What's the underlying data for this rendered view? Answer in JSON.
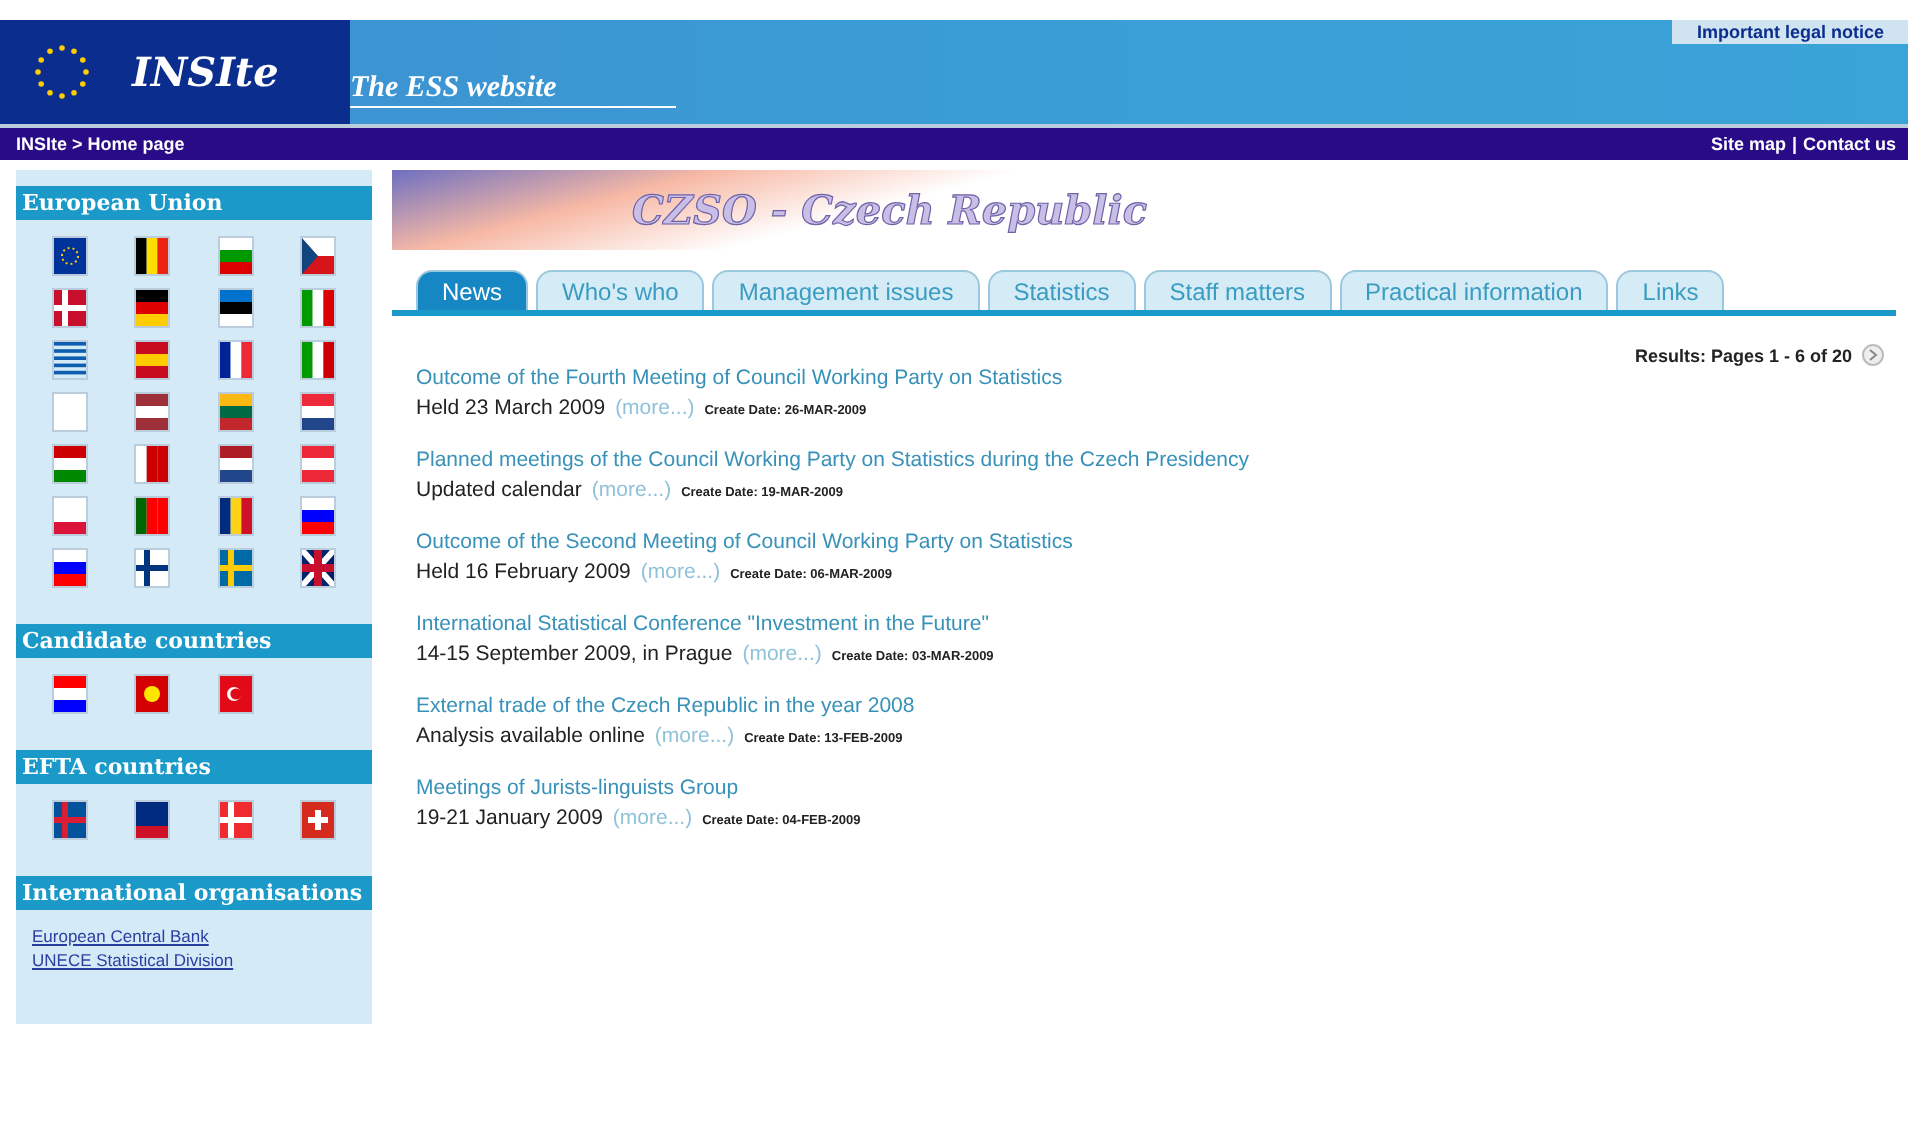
{
  "header": {
    "logo": "INSIte",
    "tagline": "The ESS website",
    "legal_link": "Important legal notice"
  },
  "breadcrumb": "INSIte > Home page",
  "top_links": [
    "Site map",
    "|",
    "Contact us"
  ],
  "sidebar": {
    "sections": [
      {
        "title": "European Union",
        "kind": "flags"
      },
      {
        "title": "Candidate countries",
        "kind": "flags"
      },
      {
        "title": "EFTA countries",
        "kind": "flags"
      },
      {
        "title": "International organisations",
        "kind": "links",
        "links": [
          "European Central Bank",
          "UNECE Statistical Division"
        ]
      }
    ]
  },
  "banner_title": "CZSO - Czech Republic",
  "tabs": [
    {
      "label": "News",
      "selected": true
    },
    {
      "label": "Who's who",
      "selected": false
    },
    {
      "label": "Management issues",
      "selected": false
    },
    {
      "label": "Statistics",
      "selected": false
    },
    {
      "label": "Staff matters",
      "selected": false
    },
    {
      "label": "Practical information",
      "selected": false
    },
    {
      "label": "Links",
      "selected": false
    }
  ],
  "results": "Results: Pages 1 - 6 of 20",
  "news": [
    {
      "title": "Outcome of the Fourth Meeting of Council Working Party on Statistics",
      "summary": "Held 23 March 2009",
      "more": "(more...)",
      "date": "Create Date: 26-MAR-2009"
    },
    {
      "title": "Planned meetings of the Council Working Party on Statistics during the Czech Presidency",
      "summary": "Updated calendar",
      "more": "(more...)",
      "date": "Create Date: 19-MAR-2009"
    },
    {
      "title": "Outcome of the Second Meeting of Council Working Party on Statistics",
      "summary": "Held 16 February 2009",
      "more": "(more...)",
      "date": "Create Date: 06-MAR-2009"
    },
    {
      "title": "International Statistical Conference \"Investment in the Future\"",
      "summary": "14-15 September 2009, in Prague",
      "more": "(more...)",
      "date": "Create Date: 03-MAR-2009"
    },
    {
      "title": "External trade of the Czech Republic in the year 2008",
      "summary": "Analysis available online",
      "more": "(more...)",
      "date": "Create Date: 13-FEB-2009"
    },
    {
      "title": "Meetings of Jurists-linguists Group",
      "summary": "19-21 January 2009",
      "more": "(more...)",
      "date": "Create Date: 04-FEB-2009"
    }
  ]
}
